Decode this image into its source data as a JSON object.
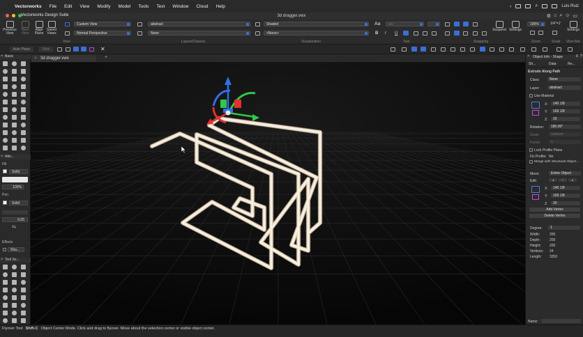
{
  "menubar": {
    "apple": "",
    "app": "Vectorworks",
    "items": [
      "File",
      "Edit",
      "View",
      "Modify",
      "Model",
      "Tools",
      "Text",
      "Window",
      "Cloud",
      "Help"
    ],
    "user": "Luis Ruiz"
  },
  "window": {
    "app_title": "Vectorworks Design Suite",
    "doc_title": "3d dragger.vwx"
  },
  "toolbar": {
    "prev_view": "Previous View",
    "next_view": "Next View",
    "align_plane": "Align Plane",
    "saved_views": "Saved Views",
    "view_select": "Custom View",
    "projection_select": "Normal Perspective",
    "class_select": "abstract",
    "layer_select": "None",
    "render_select": "Shaded",
    "lighting_select": "<None>",
    "text_select": "----",
    "suspend": "Suspend",
    "settings": "Settings",
    "zoom_value": "100%",
    "scale_value": "1/4\"=1'",
    "settings2": "Settings",
    "groups": {
      "view": "View",
      "layers": "Layers/Classes",
      "visualization": "Visualization",
      "text": "Text",
      "snapping": "Snapping",
      "zoom": "Zoom",
      "scale": "Scale",
      "view_bar": "View Bar"
    }
  },
  "subbar": {
    "auto_plane": "Auto Plane",
    "plane_value": "Slide"
  },
  "tabs": {
    "doc_tab": "3d dragger.vwx"
  },
  "left_panel": {
    "basic": "Basic",
    "attributes": "Attri...",
    "fill": "Fill",
    "fill_style": "Solid",
    "opacity": "100%",
    "pen": "Pen",
    "pen_style": "Solid",
    "line_weight": "0.05",
    "effects": "Effects",
    "shadow": "Sha...",
    "tool_sets": "Tool Se..."
  },
  "right_panel": {
    "title": "Object Info - Shape",
    "tab_shape": "Sh...",
    "tab_data": "Data",
    "tab_render": "Re...",
    "object_type": "Extrude Along Path",
    "class_label": "Class:",
    "class_value": "None",
    "layer_label": "Layer:",
    "layer_value": "abstract",
    "use_material": "Use Material",
    "x_label": "X:",
    "x_value": "140 1/8",
    "y_label": "Y:",
    "y_value": "169 1/8",
    "z_label": "Z:",
    "z_value": "20",
    "rotation_label": "Rotation:",
    "rotation_value": "180.00°",
    "scale_label": "Scale:",
    "scale_value": "Uniform",
    "factor_label": "Factor:",
    "factor_value": "1",
    "lock_profile": "Lock Profile Plane",
    "fix_profile_label": "Fix Profile:",
    "fix_profile_value": "No",
    "merge": "Merge with Structural Object...",
    "move_label": "Move:",
    "move_value": "Entire Object",
    "edit_label": "Edit:",
    "x2_value": "140 1/8",
    "y2_value": "169 1/8",
    "z2_value": "20",
    "add_vertex": "Add Vertex",
    "delete_vertex": "Delete Vertex",
    "degree_label": "Degree:",
    "degree_value": "1",
    "width_label": "Width:",
    "width_value": "200",
    "depth_label": "Depth:",
    "depth_value": "200",
    "height_label": "Height:",
    "height_value": "200",
    "vertices_label": "Vertices:",
    "vertices_value": "24",
    "length_label": "Length:",
    "length_value": "3350",
    "name_label": "Name:"
  },
  "statusbar": {
    "tool": "Flyover Tool",
    "shortcut": "Shift-C",
    "hint": "Object Center Mode. Click and drag to flyover.  Move about the selection center or visible object center."
  },
  "colors": {
    "accent": "#3d6fd8",
    "tube": "#e8dcc8",
    "gizmo_x": "#e0322f",
    "gizmo_y": "#32c64a",
    "gizmo_z": "#2f6fe8"
  }
}
